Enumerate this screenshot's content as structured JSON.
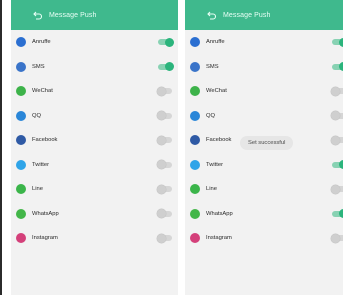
{
  "screens": [
    {
      "header_title": "Message Push",
      "items": [
        {
          "label": "Anruffe",
          "icon": "phone-icon",
          "color": "#2b6fd1",
          "on": true
        },
        {
          "label": "SMS",
          "icon": "sms-icon",
          "color": "#3a74c9",
          "on": true
        },
        {
          "label": "WeChat",
          "icon": "wechat-icon",
          "color": "#3db34a",
          "on": false
        },
        {
          "label": "QQ",
          "icon": "qq-icon",
          "color": "#2a86d8",
          "on": false
        },
        {
          "label": "Facebook",
          "icon": "facebook-icon",
          "color": "#2f5aa5",
          "on": false
        },
        {
          "label": "Twitter",
          "icon": "twitter-icon",
          "color": "#2fa4e8",
          "on": false
        },
        {
          "label": "Line",
          "icon": "line-icon",
          "color": "#3bb54a",
          "on": false
        },
        {
          "label": "WhatsApp",
          "icon": "whatsapp-icon",
          "color": "#43b649",
          "on": false
        },
        {
          "label": "Instagram",
          "icon": "instagram-icon",
          "color": "#d4407a",
          "on": false
        }
      ]
    },
    {
      "header_title": "Message Push",
      "items": [
        {
          "label": "Anruffe",
          "icon": "phone-icon",
          "color": "#2b6fd1",
          "on": true
        },
        {
          "label": "SMS",
          "icon": "sms-icon",
          "color": "#3a74c9",
          "on": true
        },
        {
          "label": "WeChat",
          "icon": "wechat-icon",
          "color": "#3db34a",
          "on": false
        },
        {
          "label": "QQ",
          "icon": "qq-icon",
          "color": "#2a86d8",
          "on": false
        },
        {
          "label": "Facebook",
          "icon": "facebook-icon",
          "color": "#2f5aa5",
          "on": false
        },
        {
          "label": "Twitter",
          "icon": "twitter-icon",
          "color": "#2fa4e8",
          "on": true
        },
        {
          "label": "Line",
          "icon": "line-icon",
          "color": "#3bb54a",
          "on": false
        },
        {
          "label": "WhatsApp",
          "icon": "whatsapp-icon",
          "color": "#43b649",
          "on": true
        },
        {
          "label": "Instagram",
          "icon": "instagram-icon",
          "color": "#d4407a",
          "on": false
        }
      ],
      "toast": "Set successful"
    }
  ]
}
